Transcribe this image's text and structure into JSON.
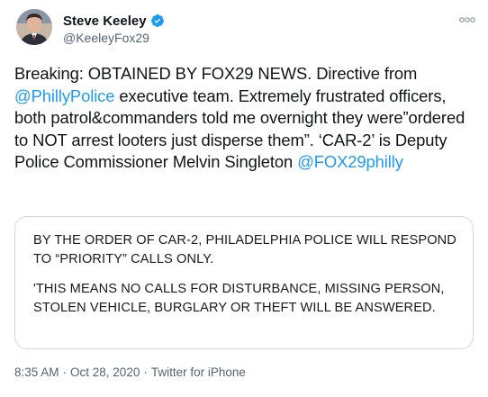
{
  "author": {
    "display_name": "Steve Keeley",
    "handle": "@KeeleyFox29",
    "verified": true,
    "avatar_icon": "profile-photo",
    "verified_icon": "verified-badge-icon"
  },
  "menu_icon": "more-options-icon",
  "tweet": {
    "part1": "Breaking: OBTAINED BY FOX29 NEWS. Directive from ",
    "mention1": "@PhillyPolice",
    "part2": " executive team. Extremely frustrated officers, both patrol&commanders told me overnight they were”ordered to NOT arrest looters just disperse them”. ‘CAR-2’ is Deputy Police Commissioner Melvin Singleton ",
    "mention2": "@FOX29philly"
  },
  "media_card": {
    "line1": "BY THE ORDER OF CAR-2, PHILADELPHIA POLICE WILL RESPOND TO “PRIORITY” CALLS ONLY.",
    "line2": "'THIS MEANS NO CALLS FOR DISTURBANCE, MISSING PERSON, STOLEN VEHICLE, BURGLARY OR THEFT WILL BE ANSWERED."
  },
  "meta": {
    "time": "8:35 AM",
    "separator": "·",
    "date": "Oct 28, 2020",
    "source": "Twitter for iPhone"
  },
  "colors": {
    "link": "#1d9bf0",
    "text": "#0f1419",
    "secondary": "#536471",
    "border": "#cfd9de"
  }
}
